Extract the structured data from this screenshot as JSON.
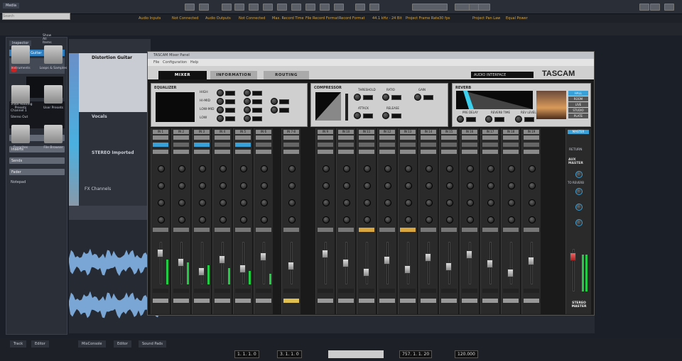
{
  "status_row": [
    "Audio Inputs",
    "Not Connected",
    "Audio Outputs",
    "Not Connected",
    "Max. Record Time",
    "File Record Format",
    "Record Format",
    "44.1 kHz - 24 Bit",
    "Project Frame Rate",
    "30 fps",
    "Project Pan Law",
    "Equal Power"
  ],
  "inspector": {
    "tab": "Inspector",
    "track": "Distortion Guitar",
    "sections": [
      "Equalizers",
      "Inserts",
      "Sends",
      "Fader"
    ],
    "notepad": "Notepad",
    "rows": [
      "Track Routing",
      "Channel 1",
      "Stereo Out"
    ]
  },
  "tracks": [
    {
      "name": "Distortion Guitar"
    },
    {
      "name": "Vocals"
    },
    {
      "name": "STEREO Imported"
    },
    {
      "name": "FX Channels"
    }
  ],
  "mixer": {
    "title": "TASCAM Mixer Panel",
    "menu": [
      "File",
      "Configuration",
      "Help"
    ],
    "tabs": [
      "MIXER",
      "INFORMATION",
      "ROUTING"
    ],
    "interface_label": "AUDIO INTERFACE",
    "brand": "TASCAM",
    "eq": {
      "title": "EQUALIZER",
      "bands": [
        "HIGH",
        "HI-MID",
        "LOW-MID",
        "LOW"
      ]
    },
    "comp": {
      "title": "COMPRESSOR",
      "params": [
        "THRESHOLD",
        "RATIO",
        "GAIN",
        "ATTACK",
        "RELEASE"
      ]
    },
    "reverb": {
      "title": "REVERB",
      "params": [
        "PRE DELAY",
        "REVERB TIME",
        "REV LEVEL"
      ],
      "types": [
        "HALL",
        "ROOM",
        "LIVE",
        "STUDIO",
        "PLATE"
      ]
    },
    "channels": [
      "IN 1",
      "IN 2",
      "IN 3",
      "IN 4",
      "IN 5",
      "IN 6",
      "IN 7-8",
      "IN 9",
      "IN 10",
      "IN 11",
      "IN 12",
      "IN 13",
      "IN 14",
      "IN 15",
      "IN 16",
      "IN 17",
      "IN 18",
      "IN 19"
    ],
    "master": {
      "top": "MASTER",
      "return": "RETURN",
      "aux": "AUX MASTER",
      "reverb": "TO REVERB",
      "label": "STEREO MASTER"
    }
  },
  "media": {
    "tab": "Media",
    "search_placeholder": "Search",
    "show_all": "Show All Items",
    "items": [
      "Instruments",
      "Loops & Samples",
      "Presets",
      "User Presets",
      "Favorites",
      "File Browser"
    ]
  },
  "bottom": {
    "tabs": [
      "Track",
      "Editor",
      "MixConsole",
      "Editor",
      "Sound Pads"
    ],
    "left_locator": "1. 1. 1. 0",
    "right_locator": "3. 1. 1. 0",
    "position": "757. 1. 1. 20",
    "tempo": "120.000"
  },
  "colors": {
    "accent": "#3aa0d8",
    "meter": "#22cc44"
  }
}
